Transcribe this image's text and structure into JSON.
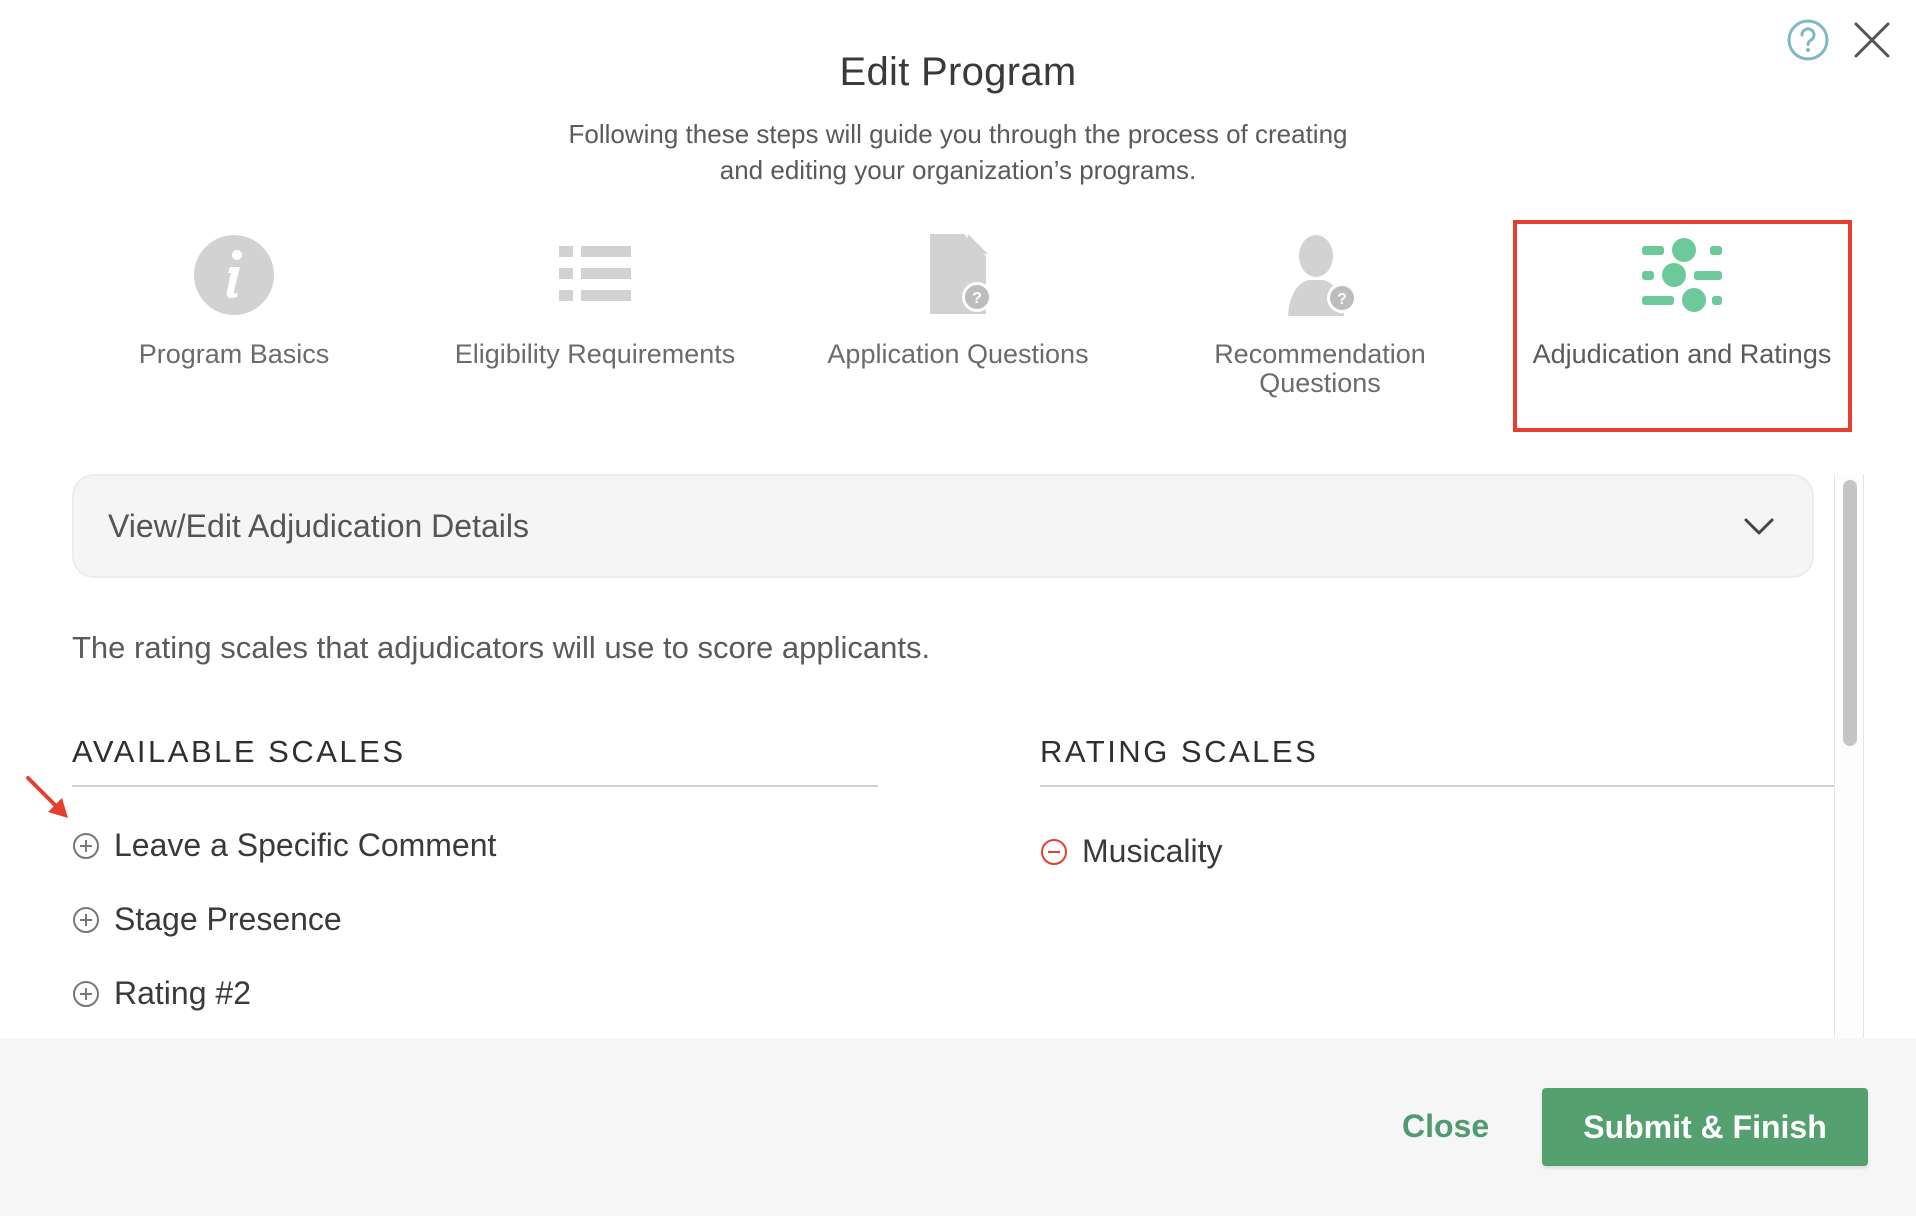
{
  "header": {
    "title": "Edit Program",
    "subtitle_line1": "Following these steps will guide you through the process of creating",
    "subtitle_line2": "and editing your organization’s programs."
  },
  "top_icons": [
    "help-circle-icon",
    "close-icon"
  ],
  "steps": [
    {
      "label": "Program Basics",
      "icon": "info-icon",
      "active": false
    },
    {
      "label": "Eligibility Requirements",
      "icon": "list-icon",
      "active": false
    },
    {
      "label": "Application Questions",
      "icon": "document-question-icon",
      "active": false
    },
    {
      "label_line1": "Recommendation",
      "label_line2": "Questions",
      "icon": "person-question-icon",
      "active": false
    },
    {
      "label": "Adjudication and Ratings",
      "icon": "sliders-icon",
      "active": true
    }
  ],
  "accordion": {
    "label": "View/Edit Adjudication Details",
    "icon": "chevron-down-icon"
  },
  "description": "The rating scales that adjudicators will use to score applicants.",
  "available_scales": {
    "heading": "AVAILABLE SCALES",
    "items": [
      {
        "label": "Leave a Specific Comment",
        "icon": "plus-circle-icon"
      },
      {
        "label": "Stage Presence",
        "icon": "plus-circle-icon"
      },
      {
        "label": "Rating #2",
        "icon": "plus-circle-icon"
      }
    ]
  },
  "rating_scales": {
    "heading": "RATING SCALES",
    "items": [
      {
        "label": "Musicality",
        "icon": "minus-circle-icon"
      }
    ]
  },
  "footer": {
    "close_label": "Close",
    "submit_label": "Submit & Finish"
  },
  "colors": {
    "accent_green": "#55a06f",
    "active_icon_green": "#6cc99a",
    "inactive_icon_gray": "#d2d2d2",
    "highlight_red": "#e4402f",
    "help_teal": "#7fb8c4"
  }
}
